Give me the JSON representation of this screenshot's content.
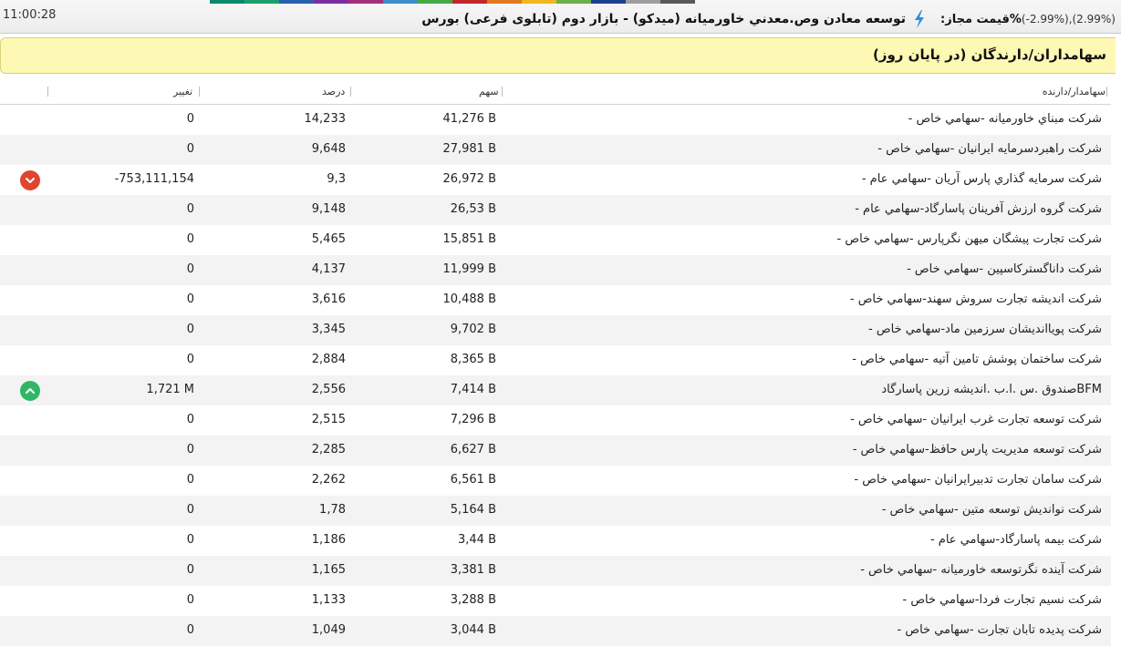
{
  "header": {
    "time": "11:00:28",
    "instrument_title": "توسعه معادن وص.معدني خاورميانه (ميدکو) - بازار دوم (تابلوی فرعی) بورس",
    "price_label": "%قیمت مجاز:",
    "price_value": "(-2.99%),(2.99%)",
    "strip_colors": [
      "#0b8a6b",
      "#1aa06a",
      "#2b5fb0",
      "#7a2fa0",
      "#a12f7c",
      "#3b8ec9",
      "#46a847",
      "#c1272d",
      "#e07a1f",
      "#f0b81e",
      "#6ab04c",
      "#1f3f8f",
      "#9e9e9e",
      "#5a5a5a"
    ]
  },
  "panel": {
    "title": "سهامداران/دارندگان (در پایان روز)"
  },
  "table": {
    "columns": {
      "holder": "سهامدار/دارنده",
      "shares": "سهم",
      "percent": "درصد",
      "change": "تغییر"
    },
    "rows": [
      {
        "holder": "شرکت مبناي خاورميانه -سهامي خاص -",
        "shares": "41,276 B",
        "percent": "14,233",
        "change": "0",
        "trend": ""
      },
      {
        "holder": "شرکت راهبردسرمايه ايرانيان -سهامي خاص -",
        "shares": "27,981 B",
        "percent": "9,648",
        "change": "0",
        "trend": ""
      },
      {
        "holder": "شرکت سرمايه گذاري پارس آريان -سهامي عام -",
        "shares": "26,972 B",
        "percent": "9,3",
        "change": "-753,111,154",
        "trend": "down"
      },
      {
        "holder": "شرکت گروه ارزش آفرينان پاسارگاد-سهامي عام -",
        "shares": "26,53 B",
        "percent": "9,148",
        "change": "0",
        "trend": ""
      },
      {
        "holder": "شرکت تجارت پيشگان ميهن نگرپارس -سهامي خاص -",
        "shares": "15,851 B",
        "percent": "5,465",
        "change": "0",
        "trend": ""
      },
      {
        "holder": "شرکت داناگسترکاسپين -سهامي خاص -",
        "shares": "11,999 B",
        "percent": "4,137",
        "change": "0",
        "trend": ""
      },
      {
        "holder": "شرکت انديشه تجارت سروش سهند-سهامي خاص -",
        "shares": "10,488 B",
        "percent": "3,616",
        "change": "0",
        "trend": ""
      },
      {
        "holder": "شرکت پويااندیشان سرزمين ماد-سهامي خاص -",
        "shares": "9,702 B",
        "percent": "3,345",
        "change": "0",
        "trend": ""
      },
      {
        "holder": "شرکت ساختمان پوشش تامين آتيه -سهامي خاص -",
        "shares": "8,365 B",
        "percent": "2,884",
        "change": "0",
        "trend": ""
      },
      {
        "holder": "BFMصندوق .س .ا.ب .انديشه زرين پاسارگاد",
        "shares": "7,414 B",
        "percent": "2,556",
        "change": "1,721 M",
        "trend": "up"
      },
      {
        "holder": "شرکت توسعه تجارت غرب ايرانيان -سهامي خاص -",
        "shares": "7,296 B",
        "percent": "2,515",
        "change": "0",
        "trend": ""
      },
      {
        "holder": "شرکت توسعه مديريت پارس حافظ-سهامي خاص -",
        "shares": "6,627 B",
        "percent": "2,285",
        "change": "0",
        "trend": ""
      },
      {
        "holder": "شرکت سامان تجارت تدبيرايرانيان -سهامي خاص -",
        "shares": "6,561 B",
        "percent": "2,262",
        "change": "0",
        "trend": ""
      },
      {
        "holder": "شرکت نوانديش توسعه متين -سهامي خاص -",
        "shares": "5,164 B",
        "percent": "1,78",
        "change": "0",
        "trend": ""
      },
      {
        "holder": "شرکت بيمه پاسارگاد-سهامي عام -",
        "shares": "3,44 B",
        "percent": "1,186",
        "change": "0",
        "trend": ""
      },
      {
        "holder": "شرکت آينده نگرتوسعه خاورميانه -سهامي خاص -",
        "shares": "3,381 B",
        "percent": "1,165",
        "change": "0",
        "trend": ""
      },
      {
        "holder": "شرکت نسيم تجارت فردا-سهامي خاص -",
        "shares": "3,288 B",
        "percent": "1,133",
        "change": "0",
        "trend": ""
      },
      {
        "holder": "شرکت پديده تابان تجارت -سهامي خاص -",
        "shares": "3,044 B",
        "percent": "1,049",
        "change": "0",
        "trend": ""
      }
    ]
  },
  "icons": {
    "down": "chevron-down-icon",
    "up": "chevron-up-icon",
    "price": "lightning-bolt-icon"
  },
  "colors": {
    "down": "#e0452f",
    "up": "#2fb765",
    "panel_bg": "#fdf8b4",
    "alt_row": "#f3f3f3"
  }
}
